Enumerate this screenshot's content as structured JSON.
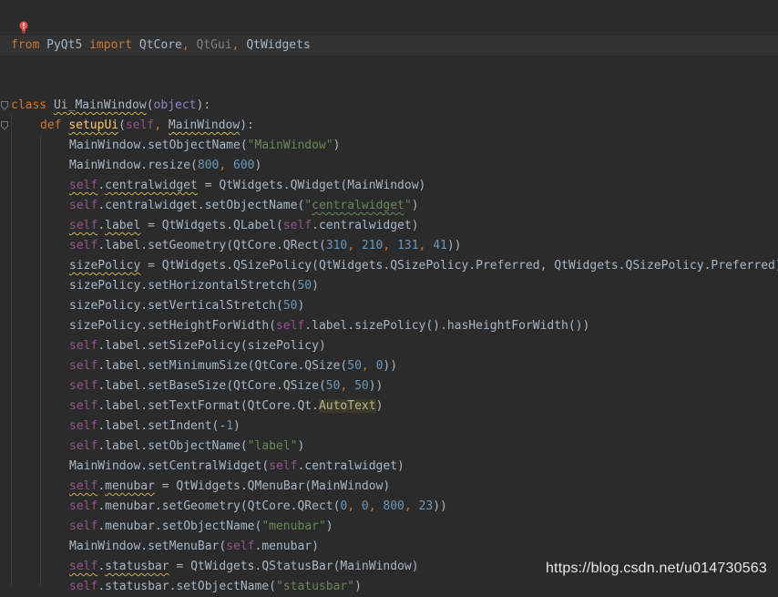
{
  "watermark": "https://blog.csdn.net/u014730563",
  "icons": {
    "intention": "lightbulb-error-icon",
    "fold": "fold-icon"
  },
  "lines": {
    "l1": [
      "from",
      " PyQt5 ",
      "import",
      " QtCore",
      ", ",
      "QtGui",
      ", ",
      "QtWidgets"
    ],
    "l2": [
      "class",
      " ",
      "Ui_MainWindow",
      "(",
      "object",
      "):"
    ],
    "l3": [
      "def",
      " ",
      "setupUi",
      "(",
      "self",
      ", ",
      "MainWindow",
      "):"
    ],
    "l4": [
      "MainWindow.setObjectName(",
      "\"MainWindow\"",
      ")"
    ],
    "l5": [
      "MainWindow.resize(",
      "800",
      ", ",
      "600",
      ")"
    ],
    "l6": [
      "self",
      ".",
      "centralwidget",
      " = QtWidgets.QWidget(MainWindow)"
    ],
    "l7": [
      "self",
      ".centralwidget.setObjectName(",
      "\"",
      "centralwidget",
      "\"",
      ")"
    ],
    "l8": [
      "self",
      ".",
      "label",
      " = QtWidgets.QLabel(",
      "self",
      ".centralwidget)"
    ],
    "l9": [
      "self",
      ".label.setGeometry(QtCore.QRect(",
      "310",
      ", ",
      "210",
      ", ",
      "131",
      ", ",
      "41",
      "))"
    ],
    "l10": [
      "sizePolicy",
      " = QtWidgets.QSizePolicy(QtWidgets.QSizePolicy.Preferred, QtWidgets.QSizePolicy.Preferred)"
    ],
    "l11": [
      "sizePolicy.setHorizontalStretch(",
      "50",
      ")"
    ],
    "l12": [
      "sizePolicy.setVerticalStretch(",
      "50",
      ")"
    ],
    "l13": [
      "sizePolicy.setHeightForWidth(",
      "self",
      ".label.sizePolicy().hasHeightForWidth())"
    ],
    "l14": [
      "self",
      ".label.setSizePolicy(sizePolicy)"
    ],
    "l15": [
      "self",
      ".label.setMinimumSize(QtCore.QSize(",
      "50",
      ", ",
      "0",
      "))"
    ],
    "l16": [
      "self",
      ".label.setBaseSize(QtCore.QSize(",
      "50",
      ", ",
      "50",
      "))"
    ],
    "l17": [
      "self",
      ".label.setTextFormat(QtCore.Qt.",
      "AutoText",
      ")"
    ],
    "l18": [
      "self",
      ".label.setIndent(-",
      "1",
      ")"
    ],
    "l19": [
      "self",
      ".label.setObjectName(",
      "\"label\"",
      ")"
    ],
    "l20": [
      "MainWindow.setCentralWidget(",
      "self",
      ".centralwidget)"
    ],
    "l21": [
      "self",
      ".",
      "menubar",
      " = QtWidgets.QMenuBar(MainWindow)"
    ],
    "l22": [
      "self",
      ".menubar.setGeometry(QtCore.QRect(",
      "0",
      ", ",
      "0",
      ", ",
      "800",
      ", ",
      "23",
      "))"
    ],
    "l23": [
      "self",
      ".menubar.setObjectName(",
      "\"menubar\"",
      ")"
    ],
    "l24": [
      "MainWindow.setMenuBar(",
      "self",
      ".menubar)"
    ],
    "l25": [
      "self",
      ".",
      "statusbar",
      " = QtWidgets.QStatusBar(MainWindow)"
    ],
    "l26": [
      "self",
      ".statusbar.setObjectName(",
      "\"statusbar\"",
      ")"
    ]
  }
}
